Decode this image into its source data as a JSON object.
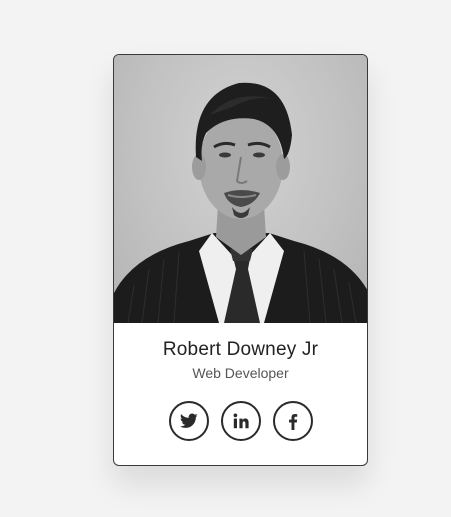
{
  "profile": {
    "name": "Robert Downey Jr",
    "role": "Web Developer"
  },
  "social": [
    {
      "icon": "twitter-icon"
    },
    {
      "icon": "linkedin-icon"
    },
    {
      "icon": "facebook-icon"
    }
  ],
  "colors": {
    "background": "#f3f3f3",
    "card": "#ffffff",
    "border": "#3a3a3a",
    "text": "#222222"
  }
}
